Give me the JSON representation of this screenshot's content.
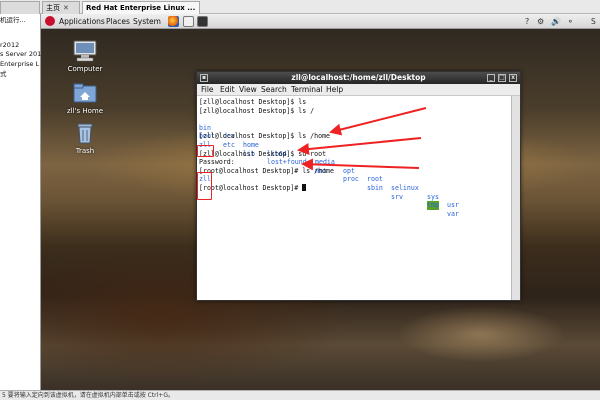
{
  "host": {
    "tabs": [
      {
        "label": "主页",
        "close": "✕"
      },
      {
        "label": "Red Hat Enterprise Linux ...",
        "close": "✕"
      }
    ],
    "left_panel_lines": [
      "机运行...",
      "r2012",
      "s Server 201",
      "Enterprise L",
      "式"
    ],
    "status_text": "5  要将输入定向到该虚拟机，请在虚拟机内部单击或按 Ctrl+G。"
  },
  "panel": {
    "menus": [
      "Applications",
      "Places",
      "System"
    ],
    "right_label": "S"
  },
  "desktop": {
    "icons": [
      {
        "label": "Computer",
        "icon": "computer-icon"
      },
      {
        "label": "zll's Home",
        "icon": "home-folder-icon"
      },
      {
        "label": "Trash",
        "icon": "trash-icon"
      }
    ]
  },
  "terminal": {
    "title": "zll@localhost:/home/zll/Desktop",
    "menus": [
      "File",
      "Edit",
      "View",
      "Search",
      "Terminal",
      "Help"
    ],
    "lines": [
      "[zll@localhost Desktop]$ ls",
      "[zll@localhost Desktop]$ ls /",
      "[zll@localhost Desktop]$ ls /home",
      "zll",
      "[zll@localhost Desktop]$ su root",
      "Password:",
      "[root@localhost Desktop]# ls /home",
      "zll",
      "[root@localhost Desktop]# "
    ],
    "ls_root_row1": [
      "bin",
      "dev",
      "home",
      "lib64",
      "media",
      "opt",
      "root",
      "selinux",
      "sys",
      "usr"
    ],
    "ls_root_row2": [
      "boot",
      "etc",
      "lib",
      "lost+found",
      "mnt",
      "proc",
      "sbin",
      "srv",
      "tmp",
      "var"
    ]
  },
  "colors": {
    "annotation": "#e22222",
    "dir": "#2a63d8",
    "tmp_bg": "#5aa32a"
  }
}
